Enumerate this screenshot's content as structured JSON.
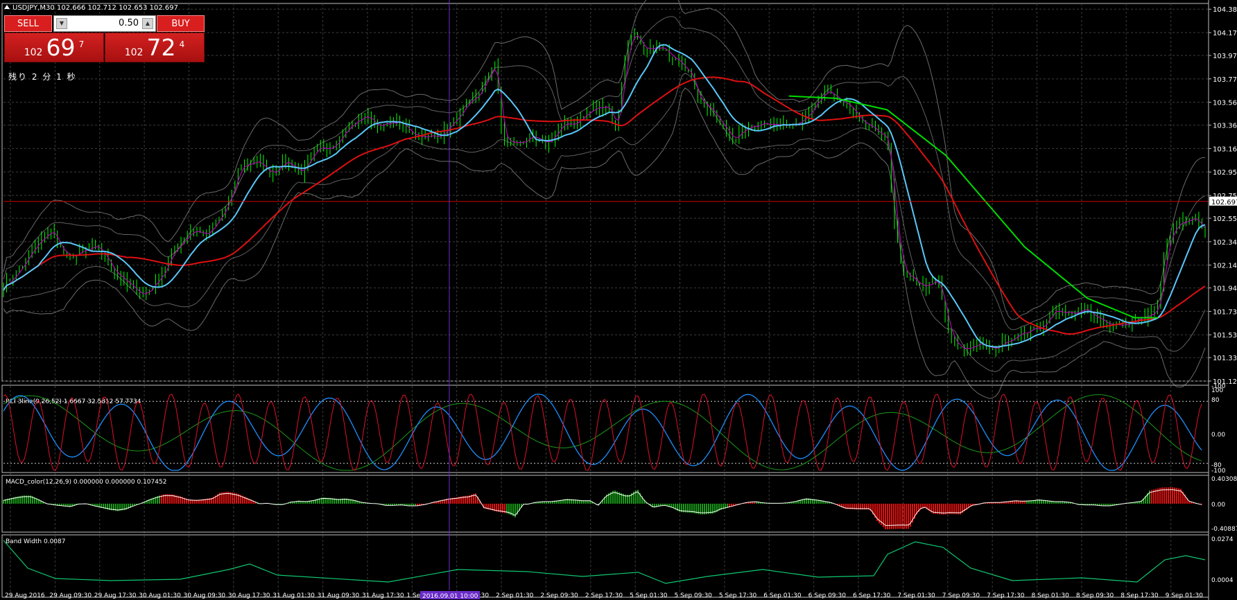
{
  "header": {
    "symbol": "USDJPY,M30",
    "ohlc": "102.666 102.712 102.653 102.697"
  },
  "trade_panel": {
    "sell_label": "SELL",
    "buy_label": "BUY",
    "lot": "0.50",
    "bid_prefix": "102",
    "bid_big": "69",
    "bid_sup": "7",
    "ask_prefix": "102",
    "ask_big": "72",
    "ask_sup": "4",
    "timer": "残り 2 分 1 秒"
  },
  "colors": {
    "grid": "#3a3f3a",
    "candle": "#00ff00",
    "bb_band": "#8a8a8a",
    "ma_fast": "#b000b0",
    "ma_mid": "#5ac8fa",
    "ma_slow": "#e01010",
    "ma_zigzag": "#00dd00",
    "price_line": "#d00000",
    "crosshair": "#6a2bc8",
    "rci_short": "#e0102a",
    "rci_mid": "#1e90ff",
    "rci_long": "#1a9a1a",
    "macd_up": "#1a9a1a",
    "macd_down": "#e01010",
    "bandwidth": "#10c870"
  },
  "chart_data": [
    {
      "type": "line",
      "title": "USDJPY,M30",
      "subtitle": "102.666 102.712 102.653 102.697",
      "y_ticks": [
        104.38,
        104.175,
        103.975,
        103.77,
        103.565,
        103.365,
        103.16,
        102.955,
        102.75,
        102.55,
        102.345,
        102.14,
        101.94,
        101.735,
        101.53,
        101.33,
        101.125
      ],
      "y_tick_labels": [
        "104.380",
        "104.175",
        "103.975",
        "103.770",
        "103.565",
        "103.365",
        "103.160",
        "102.955",
        "102.750",
        "102.550",
        "102.345",
        "102.140",
        "101.940",
        "101.735",
        "101.530",
        "101.330",
        "101.125"
      ],
      "ylim": [
        101.125,
        104.43
      ],
      "current_price": "102.697",
      "x_labels": [
        "29 Aug 2016",
        "29 Aug 09:30",
        "29 Aug 17:30",
        "30 Aug 01:30",
        "30 Aug 09:30",
        "30 Aug 17:30",
        "31 Aug 01:30",
        "31 Aug 09:30",
        "31 Aug 17:30",
        "1 Sep",
        "1 Sep 17:30",
        "2 Sep 01:30",
        "2 Sep 09:30",
        "2 Sep 17:30",
        "5 Sep 01:30",
        "5 Sep 09:30",
        "5 Sep 17:30",
        "6 Sep 01:30",
        "6 Sep 09:30",
        "6 Sep 17:30",
        "7 Sep 01:30",
        "7 Sep 09:30",
        "7 Sep 17:30",
        "8 Sep 01:30",
        "8 Sep 09:30",
        "8 Sep 17:30",
        "9 Sep 01:30"
      ],
      "crosshair_label": "2016.09.01 10:00",
      "close_path": [
        [
          0,
          101.95
        ],
        [
          20,
          102.1
        ],
        [
          40,
          102.3
        ],
        [
          60,
          102.45
        ],
        [
          80,
          102.2
        ],
        [
          100,
          102.25
        ],
        [
          120,
          102.3
        ],
        [
          140,
          102.1
        ],
        [
          160,
          101.95
        ],
        [
          180,
          101.88
        ],
        [
          200,
          102.05
        ],
        [
          220,
          102.3
        ],
        [
          240,
          102.45
        ],
        [
          260,
          102.4
        ],
        [
          275,
          102.55
        ],
        [
          290,
          102.75
        ],
        [
          300,
          103.0
        ],
        [
          320,
          103.05
        ],
        [
          340,
          102.95
        ],
        [
          360,
          103.05
        ],
        [
          380,
          102.95
        ],
        [
          400,
          103.15
        ],
        [
          420,
          103.2
        ],
        [
          440,
          103.35
        ],
        [
          460,
          103.45
        ],
        [
          480,
          103.35
        ],
        [
          500,
          103.4
        ],
        [
          520,
          103.3
        ],
        [
          540,
          103.25
        ],
        [
          560,
          103.3
        ],
        [
          580,
          103.45
        ],
        [
          600,
          103.6
        ],
        [
          615,
          103.75
        ],
        [
          625,
          103.95
        ],
        [
          635,
          103.25
        ],
        [
          650,
          103.2
        ],
        [
          670,
          103.25
        ],
        [
          690,
          103.2
        ],
        [
          710,
          103.35
        ],
        [
          730,
          103.4
        ],
        [
          750,
          103.5
        ],
        [
          770,
          103.55
        ],
        [
          780,
          103.3
        ],
        [
          790,
          103.9
        ],
        [
          800,
          104.2
        ],
        [
          815,
          104.0
        ],
        [
          830,
          104.05
        ],
        [
          845,
          104.0
        ],
        [
          860,
          103.95
        ],
        [
          875,
          103.8
        ],
        [
          885,
          103.6
        ],
        [
          900,
          103.5
        ],
        [
          915,
          103.35
        ],
        [
          930,
          103.25
        ],
        [
          950,
          103.35
        ],
        [
          970,
          103.4
        ],
        [
          990,
          103.35
        ],
        [
          1010,
          103.4
        ],
        [
          1030,
          103.5
        ],
        [
          1045,
          103.65
        ],
        [
          1060,
          103.6
        ],
        [
          1075,
          103.55
        ],
        [
          1090,
          103.4
        ],
        [
          1110,
          103.3
        ],
        [
          1125,
          103.25
        ],
        [
          1135,
          102.5
        ],
        [
          1145,
          102.05
        ],
        [
          1160,
          102.0
        ],
        [
          1175,
          101.95
        ],
        [
          1190,
          102.0
        ],
        [
          1205,
          101.5
        ],
        [
          1220,
          101.4
        ],
        [
          1240,
          101.45
        ],
        [
          1260,
          101.4
        ],
        [
          1280,
          101.5
        ],
        [
          1300,
          101.55
        ],
        [
          1320,
          101.6
        ],
        [
          1340,
          101.75
        ],
        [
          1360,
          101.7
        ],
        [
          1380,
          101.75
        ],
        [
          1400,
          101.65
        ],
        [
          1420,
          101.6
        ],
        [
          1440,
          101.65
        ],
        [
          1460,
          101.7
        ],
        [
          1470,
          101.75
        ],
        [
          1480,
          102.3
        ],
        [
          1495,
          102.5
        ],
        [
          1510,
          102.55
        ],
        [
          1525,
          102.5
        ],
        [
          1530,
          102.45
        ]
      ]
    },
    {
      "type": "line",
      "title": "RCI 3line(9,26,52) 1.6667 32.5812 57.7734",
      "y_tick_labels": [
        "100",
        "80",
        "0.00",
        "-80",
        "-100",
        "-100"
      ],
      "ylim": [
        -100,
        100
      ],
      "series": []
    },
    {
      "type": "bar",
      "title": "MACD_color(12,26,9) 0.000000 0.000000 0.107452",
      "y_tick_labels": [
        "0.403082",
        "0.00",
        "-0.408874"
      ],
      "ylim": [
        -0.408874,
        0.403082
      ]
    },
    {
      "type": "line",
      "title": "Band Width 0.0087",
      "y_tick_labels": [
        "0.0274",
        "0.0004"
      ],
      "ylim": [
        0.0004,
        0.0274
      ]
    }
  ]
}
